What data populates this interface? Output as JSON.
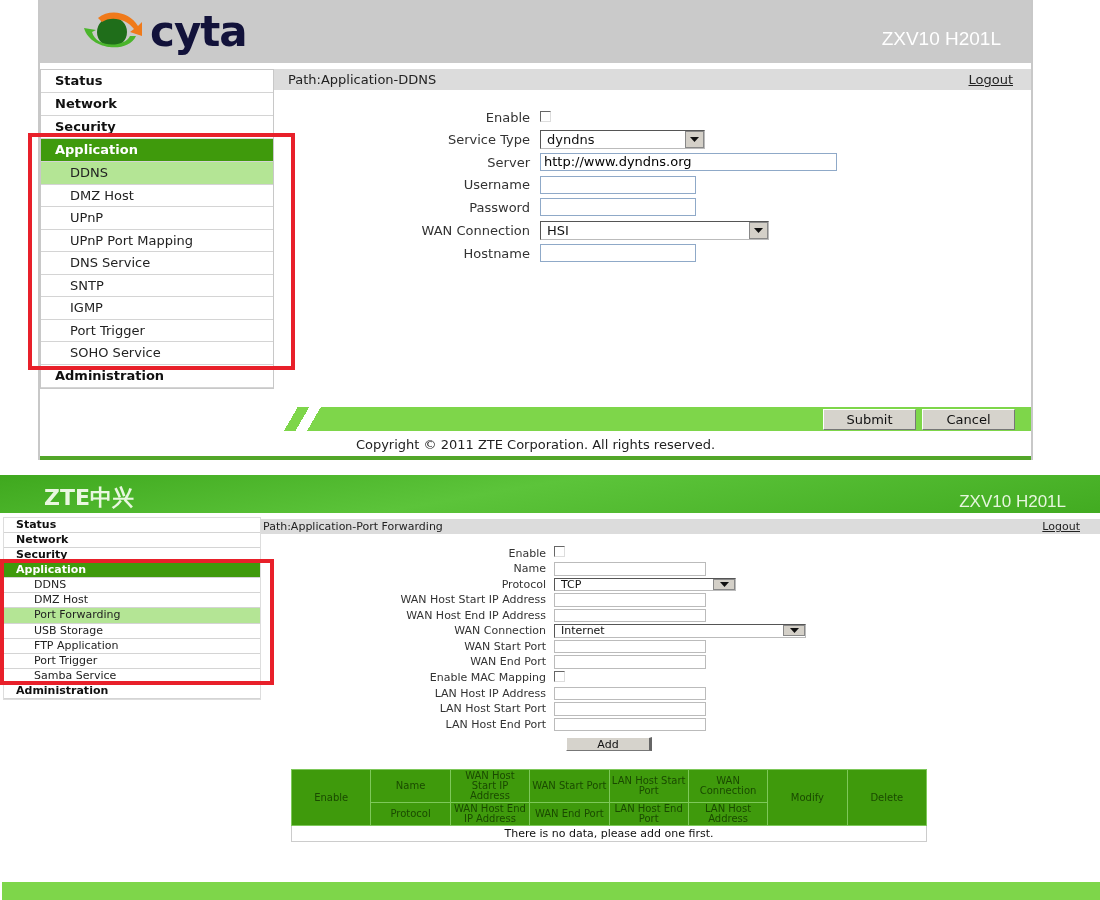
{
  "panels": [
    {
      "kind": "cyta",
      "logo": "cyta",
      "model": "ZXV10 H201L",
      "path": "Path:Application-DDNS",
      "logout": "Logout",
      "sidebar": [
        {
          "label": "Status",
          "selected": false
        },
        {
          "label": "Network",
          "selected": false
        },
        {
          "label": "Security",
          "selected": false
        },
        {
          "label": "Application",
          "selected": true,
          "children": [
            {
              "label": "DDNS",
              "selected": true
            },
            {
              "label": "DMZ Host",
              "selected": false
            },
            {
              "label": "UPnP",
              "selected": false
            },
            {
              "label": "UPnP Port Mapping",
              "selected": false
            },
            {
              "label": "DNS Service",
              "selected": false
            },
            {
              "label": "SNTP",
              "selected": false
            },
            {
              "label": "IGMP",
              "selected": false
            },
            {
              "label": "Port Trigger",
              "selected": false
            },
            {
              "label": "SOHO Service",
              "selected": false
            }
          ]
        },
        {
          "label": "Administration",
          "selected": false
        }
      ],
      "fields": [
        {
          "kind": "checkbox",
          "label": "Enable",
          "checked": false
        },
        {
          "kind": "select",
          "label": "Service Type",
          "value": "dyndns"
        },
        {
          "kind": "text",
          "label": "Server",
          "value": "http://www.dyndns.org"
        },
        {
          "kind": "text",
          "label": "Username"
        },
        {
          "kind": "text",
          "label": "Password"
        },
        {
          "kind": "select",
          "label": "WAN Connection",
          "value": "HSI"
        },
        {
          "kind": "text",
          "label": "Hostname"
        }
      ],
      "buttons": [
        "Submit",
        "Cancel"
      ],
      "copyright": "Copyright © 2011 ZTE Corporation. All rights reserved."
    },
    {
      "kind": "zte",
      "logo": "ZTE中兴",
      "model": "ZXV10 H201L",
      "path": "Path:Application-Port Forwarding",
      "logout": "Logout",
      "sidebar": [
        {
          "label": "Status",
          "selected": false
        },
        {
          "label": "Network",
          "selected": false
        },
        {
          "label": "Security",
          "selected": false
        },
        {
          "label": "Application",
          "selected": true,
          "children": [
            {
              "label": "DDNS",
              "selected": false
            },
            {
              "label": "DMZ Host",
              "selected": false
            },
            {
              "label": "Port Forwarding",
              "selected": true
            },
            {
              "label": "USB Storage",
              "selected": false
            },
            {
              "label": "FTP Application",
              "selected": false
            },
            {
              "label": "Port Trigger",
              "selected": false
            },
            {
              "label": "Samba Service",
              "selected": false
            }
          ]
        },
        {
          "label": "Administration",
          "selected": false
        }
      ],
      "fields": [
        {
          "kind": "checkbox",
          "label": "Enable",
          "checked": false
        },
        {
          "kind": "text",
          "label": "Name"
        },
        {
          "kind": "select",
          "label": "Protocol",
          "value": "TCP"
        },
        {
          "kind": "text",
          "label": "WAN Host Start IP Address"
        },
        {
          "kind": "text",
          "label": "WAN Host End IP Address"
        },
        {
          "kind": "select",
          "label": "WAN Connection",
          "value": "Internet"
        },
        {
          "kind": "text",
          "label": "WAN Start Port"
        },
        {
          "kind": "text",
          "label": "WAN End Port"
        },
        {
          "kind": "checkbox",
          "label": "Enable MAC Mapping",
          "checked": false
        },
        {
          "kind": "text",
          "label": "LAN Host IP Address"
        },
        {
          "kind": "text",
          "label": "LAN Host Start Port"
        },
        {
          "kind": "text",
          "label": "LAN Host End Port"
        }
      ],
      "add_button": "Add",
      "table": {
        "columns": [
          {
            "top": "Enable"
          },
          {
            "top": "Name",
            "bottom": "Protocol"
          },
          {
            "top": "WAN Host Start IP Address",
            "bottom": "WAN Host End IP Address"
          },
          {
            "top": "WAN Start Port",
            "bottom": "WAN End Port"
          },
          {
            "top": "LAN Host Start Port",
            "bottom": "LAN Host End Port"
          },
          {
            "top": "WAN Connection",
            "bottom": "LAN Host Address"
          },
          {
            "top": "Modify"
          },
          {
            "top": "Delete"
          }
        ],
        "empty_message": "There is no data, please add one first."
      }
    }
  ]
}
